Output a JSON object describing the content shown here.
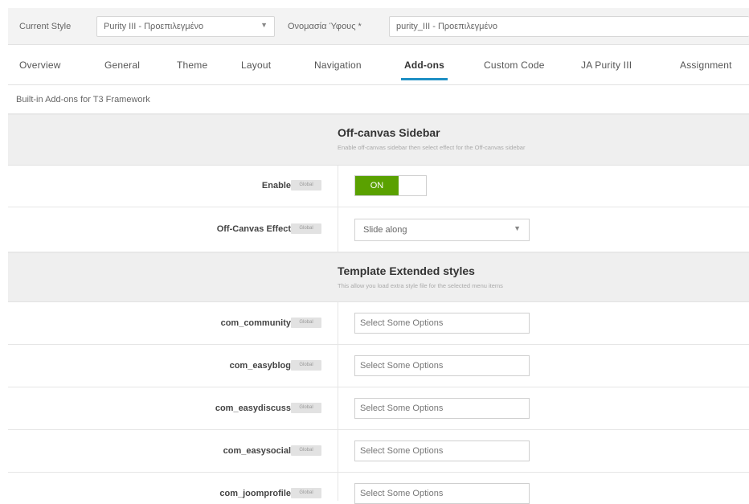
{
  "stylebar": {
    "current_style_label": "Current Style",
    "current_style_value": "Purity III - Προεπιλεγμένο",
    "style_name_label": "Ονομασία Ύφους *",
    "style_name_value": "purity_III - Προεπιλεγμένο"
  },
  "tabs": [
    {
      "label": "Overview"
    },
    {
      "label": "General"
    },
    {
      "label": "Theme"
    },
    {
      "label": "Layout"
    },
    {
      "label": "Navigation"
    },
    {
      "label": "Add-ons",
      "active": true
    },
    {
      "label": "Custom Code"
    },
    {
      "label": "JA Purity III"
    },
    {
      "label": "Assignment"
    }
  ],
  "subheader": "Built-in Add-ons for T3 Framework",
  "badge_text": "Global",
  "offcanvas": {
    "title": "Off-canvas Sidebar",
    "description": "Enable off-canvas sidebar then select effect for the Off-canvas sidebar",
    "enable_label": "Enable",
    "enable_state": "ON",
    "effect_label": "Off-Canvas Effect",
    "effect_value": "Slide along"
  },
  "extended": {
    "title": "Template Extended styles",
    "description": "This allow you load extra style file for the selected menu items",
    "placeholder": "Select Some Options",
    "items": [
      {
        "label": "com_community"
      },
      {
        "label": "com_easyblog"
      },
      {
        "label": "com_easydiscuss"
      },
      {
        "label": "com_easysocial"
      },
      {
        "label": "com_joomprofile"
      }
    ]
  },
  "colors": {
    "accent": "#1f8fc4",
    "toggle_on": "#5aa100"
  }
}
